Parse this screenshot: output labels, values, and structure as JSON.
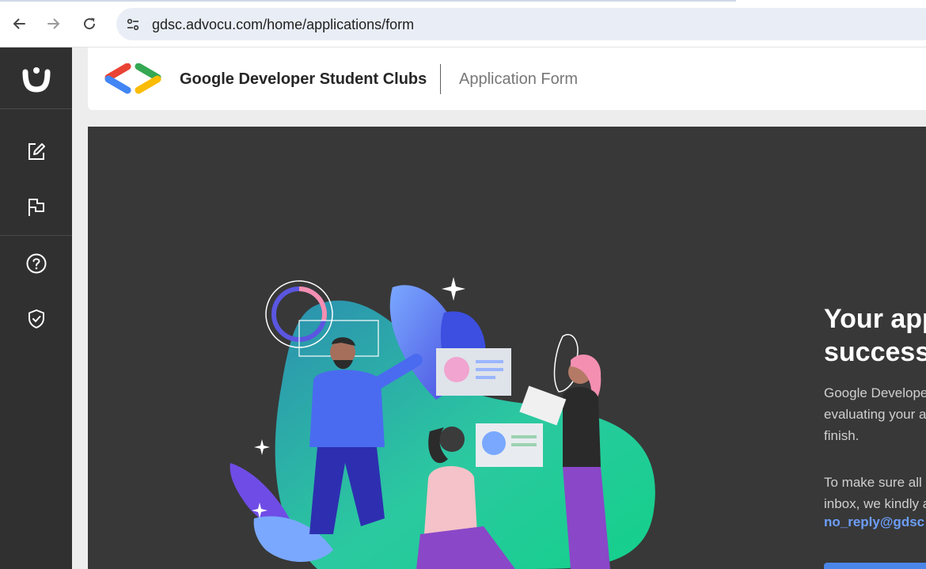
{
  "browser": {
    "url": "gdsc.advocu.com/home/applications/form",
    "icons": {
      "back": "arrow-left-icon",
      "forward": "arrow-right-icon",
      "reload": "reload-icon",
      "site_info": "tune-icon"
    }
  },
  "sidebar": {
    "logo": "advocu-logo",
    "items": [
      {
        "name": "edit-icon"
      },
      {
        "name": "flag-icon"
      },
      {
        "name": "help-icon"
      },
      {
        "name": "shield-check-icon"
      }
    ]
  },
  "header": {
    "brand": "Google Developer Student Clubs",
    "subtitle": "Application Form"
  },
  "main": {
    "title_line1": "Your app",
    "title_line2": "success",
    "p1_line1": "Google Develope",
    "p1_line2": "evaluating your a",
    "p1_line3": "finish.",
    "p2_line1": "To make sure all",
    "p2_line2": "inbox, we kindly a",
    "email": "no_reply@gdsc"
  },
  "colors": {
    "sidebar_bg": "#303030",
    "panel_bg": "#383838",
    "accent_blue": "#4a86e8",
    "link_blue": "#6c9ef8"
  }
}
